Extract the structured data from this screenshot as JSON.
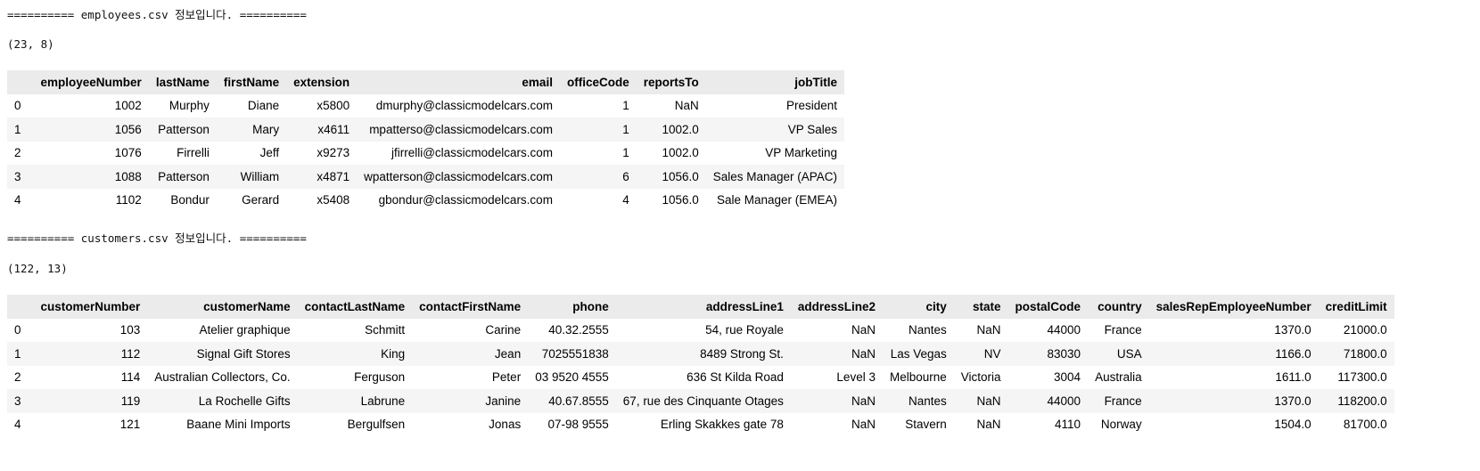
{
  "employees": {
    "header_line": "========== employees.csv 정보입니다. ==========",
    "shape": "(23, 8)",
    "columns": [
      "",
      "employeeNumber",
      "lastName",
      "firstName",
      "extension",
      "email",
      "officeCode",
      "reportsTo",
      "jobTitle"
    ],
    "rows": [
      [
        "0",
        "1002",
        "Murphy",
        "Diane",
        "x5800",
        "dmurphy@classicmodelcars.com",
        "1",
        "NaN",
        "President"
      ],
      [
        "1",
        "1056",
        "Patterson",
        "Mary",
        "x4611",
        "mpatterso@classicmodelcars.com",
        "1",
        "1002.0",
        "VP Sales"
      ],
      [
        "2",
        "1076",
        "Firrelli",
        "Jeff",
        "x9273",
        "jfirrelli@classicmodelcars.com",
        "1",
        "1002.0",
        "VP Marketing"
      ],
      [
        "3",
        "1088",
        "Patterson",
        "William",
        "x4871",
        "wpatterson@classicmodelcars.com",
        "6",
        "1056.0",
        "Sales Manager (APAC)"
      ],
      [
        "4",
        "1102",
        "Bondur",
        "Gerard",
        "x5408",
        "gbondur@classicmodelcars.com",
        "4",
        "1056.0",
        "Sale Manager (EMEA)"
      ]
    ]
  },
  "customers": {
    "header_line": "========== customers.csv 정보입니다. ==========",
    "shape": "(122, 13)",
    "columns": [
      "",
      "customerNumber",
      "customerName",
      "contactLastName",
      "contactFirstName",
      "phone",
      "addressLine1",
      "addressLine2",
      "city",
      "state",
      "postalCode",
      "country",
      "salesRepEmployeeNumber",
      "creditLimit"
    ],
    "rows": [
      [
        "0",
        "103",
        "Atelier graphique",
        "Schmitt",
        "Carine",
        "40.32.2555",
        "54, rue Royale",
        "NaN",
        "Nantes",
        "NaN",
        "44000",
        "France",
        "1370.0",
        "21000.0"
      ],
      [
        "1",
        "112",
        "Signal Gift Stores",
        "King",
        "Jean",
        "7025551838",
        "8489 Strong St.",
        "NaN",
        "Las Vegas",
        "NV",
        "83030",
        "USA",
        "1166.0",
        "71800.0"
      ],
      [
        "2",
        "114",
        "Australian Collectors, Co.",
        "Ferguson",
        "Peter",
        "03 9520 4555",
        "636 St Kilda Road",
        "Level 3",
        "Melbourne",
        "Victoria",
        "3004",
        "Australia",
        "1611.0",
        "117300.0"
      ],
      [
        "3",
        "119",
        "La Rochelle Gifts",
        "Labrune",
        "Janine",
        "40.67.8555",
        "67, rue des Cinquante Otages",
        "NaN",
        "Nantes",
        "NaN",
        "44000",
        "France",
        "1370.0",
        "118200.0"
      ],
      [
        "4",
        "121",
        "Baane Mini Imports",
        "Bergulfsen",
        "Jonas",
        "07-98 9555",
        "Erling Skakkes gate 78",
        "NaN",
        "Stavern",
        "NaN",
        "4110",
        "Norway",
        "1504.0",
        "81700.0"
      ]
    ]
  }
}
